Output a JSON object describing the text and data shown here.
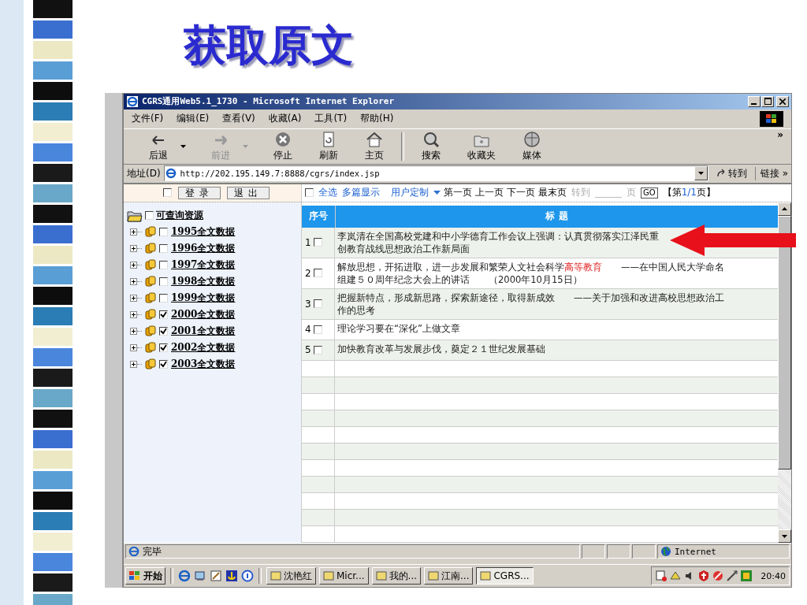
{
  "slide_title": "获取原文",
  "window": {
    "title": "CGRS通用Web5.1_1730 - Microsoft Internet Explorer"
  },
  "menu": [
    "文件(F)",
    "编辑(E)",
    "查看(V)",
    "收藏(A)",
    "工具(T)",
    "帮助(H)"
  ],
  "toolbar": [
    {
      "label": "后退",
      "disabled": false,
      "dropdown": true
    },
    {
      "label": "前进",
      "disabled": true,
      "dropdown": true
    },
    {
      "label": "停止",
      "disabled": false,
      "dropdown": false
    },
    {
      "label": "刷新",
      "disabled": false,
      "dropdown": false
    },
    {
      "label": "主页",
      "disabled": false,
      "dropdown": false
    },
    {
      "label": "搜索",
      "disabled": false,
      "dropdown": false
    },
    {
      "label": "收藏夹",
      "disabled": false,
      "dropdown": false
    },
    {
      "label": "媒体",
      "disabled": false,
      "dropdown": false
    }
  ],
  "toolbar_more": "»",
  "address_bar": {
    "label": "地址(D)",
    "value": "http://202.195.149.7:8888/cgrs/index.jsp",
    "go": "转到",
    "links": "链接 »"
  },
  "login": {
    "checked": false,
    "buttons": [
      "登录",
      "退出"
    ]
  },
  "tree": {
    "label": "可查询资源",
    "checked": false,
    "children": [
      {
        "label": "1995全文数据",
        "checked": false,
        "expanded": false
      },
      {
        "label": "1996全文数据",
        "checked": false,
        "expanded": false
      },
      {
        "label": "1997全文数据",
        "checked": false,
        "expanded": false
      },
      {
        "label": "1998全文数据",
        "checked": false,
        "expanded": false
      },
      {
        "label": "1999全文数据",
        "checked": false,
        "expanded": false
      },
      {
        "label": "2000全文数据",
        "checked": true,
        "expanded": false
      },
      {
        "label": "2001全文数据",
        "checked": true,
        "expanded": false
      },
      {
        "label": "2002全文数据",
        "checked": true,
        "expanded": false
      },
      {
        "label": "2003全文数据",
        "checked": true,
        "expanded": false
      }
    ]
  },
  "list_toolbar": {
    "select_all": {
      "label": "全选",
      "checked": false
    },
    "multi_view": "多篇显示",
    "customize": "用户定制",
    "pages": [
      "第一页",
      "上一页",
      "下一页",
      "最末页"
    ],
    "goto": "转到",
    "page_unit": "页",
    "go_button": "GO",
    "page_indicator": {
      "prefix": "【第",
      "current": "1/1",
      "suffix": "页】"
    }
  },
  "table": {
    "columns": [
      "序号",
      "标 题"
    ],
    "rows": [
      {
        "number": "1",
        "checked": false,
        "lines": [
          [
            {
              "text": "李岚清在全国高校党建和中小学德育工作会议上强调：认真贯彻落实江泽民重",
              "highlight": false
            }
          ],
          [
            {
              "text": "创教育战线思想政治工作新局面",
              "highlight": false
            }
          ]
        ]
      },
      {
        "number": "2",
        "checked": false,
        "lines": [
          [
            {
              "text": "解放思想，开拓进取，进一步发展和繁荣人文社会科学",
              "highlight": false
            },
            {
              "text": "高等教育",
              "highlight": true
            },
            {
              "text": "　　——在中国人民大学命名",
              "highlight": false
            }
          ],
          [
            {
              "text": "组建５０周年纪念大会上的讲话　　（2000年10月15日）",
              "highlight": false
            }
          ]
        ]
      },
      {
        "number": "3",
        "checked": false,
        "lines": [
          [
            {
              "text": "把握新特点，形成新思路，探索新途径，取得新成效　　——关于加强和改进高校思想政治工",
              "highlight": false
            }
          ],
          [
            {
              "text": "作的思考",
              "highlight": false
            }
          ]
        ]
      },
      {
        "number": "4",
        "checked": false,
        "lines": [
          [
            {
              "text": "理论学习要在“深化”上做文章",
              "highlight": false
            }
          ]
        ]
      },
      {
        "number": "5",
        "checked": false,
        "lines": [
          [
            {
              "text": "加快教育改革与发展步伐，奠定２１世纪发展基础",
              "highlight": false
            }
          ]
        ]
      }
    ]
  },
  "status_bar": {
    "text": "完毕",
    "zone": "Internet"
  },
  "taskbar": {
    "start": "开始",
    "tasks": [
      {
        "label": "沈艳红",
        "selected": false
      },
      {
        "label": "Micr...",
        "selected": false
      },
      {
        "label": "我的...",
        "selected": false
      },
      {
        "label": "江南...",
        "selected": false
      },
      {
        "label": "CGRS...",
        "selected": true
      }
    ],
    "clock": "20:40"
  }
}
